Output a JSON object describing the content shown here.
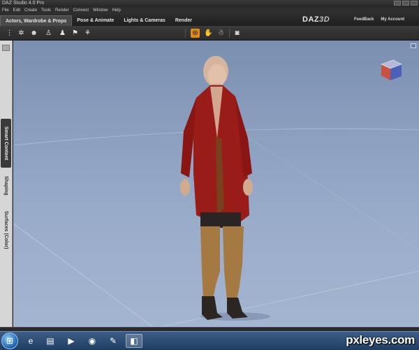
{
  "window": {
    "title": "DAZ Studio 4.0 Pro"
  },
  "menu": [
    "File",
    "Edit",
    "Create",
    "Tools",
    "Render",
    "Connect",
    "Window",
    "Help"
  ],
  "tabs": [
    {
      "label": "Actors, Wardrobe & Props",
      "active": true
    },
    {
      "label": "Pose & Animate",
      "active": false
    },
    {
      "label": "Lights & Cameras",
      "active": false
    },
    {
      "label": "Render",
      "active": false
    }
  ],
  "brand": {
    "logo_left": "DAZ",
    "logo_right": "3D"
  },
  "top_links": {
    "feedback": "FeedBack",
    "account": "My Account"
  },
  "toolbar": {
    "left_tools": [
      "content-tool-icon",
      "figure-tool-icon",
      "actor-tool-icon",
      "wardrobe-tool-icon",
      "props-tool-icon",
      "scene-tool-icon"
    ],
    "center_tools": [
      "universal-tool-icon",
      "node-tool-icon",
      "figure-pose-icon",
      "camera-render-icon"
    ],
    "active_tool": "universal-tool-icon",
    "accent_color": "#e08a1a"
  },
  "side_tabs": [
    {
      "label": "Smart Content",
      "active": true
    },
    {
      "label": "Shaping",
      "active": false
    },
    {
      "label": "Surfaces (Color)",
      "active": false
    }
  ],
  "viewport": {
    "background": "#8da0c0",
    "grid_color": "#c8d2e4"
  },
  "taskbar": {
    "apps": [
      "windows-start-icon",
      "ie-icon",
      "folder-icon",
      "media-player-icon",
      "firefox-icon",
      "paint-icon",
      "daz-app-icon"
    ]
  },
  "watermark": "pxleyes.com"
}
